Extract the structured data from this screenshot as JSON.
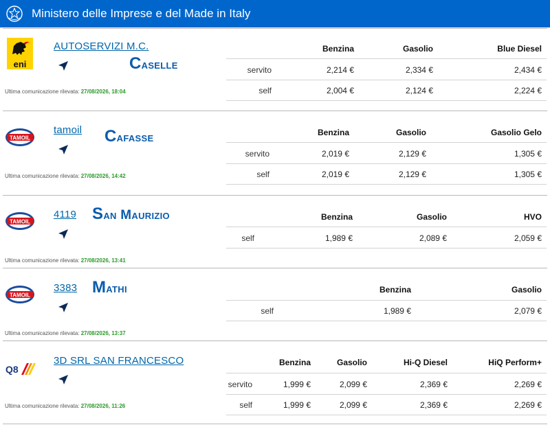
{
  "header": {
    "title": "Ministero delle Imprese e del Made in Italy"
  },
  "last_comm_label": "Ultima comunicazione rilevata:",
  "colors": {
    "header_bg": "#0066cc",
    "link": "#0066aa",
    "city": "#0a5cad",
    "date": "#2a9a2a"
  },
  "stations": [
    {
      "brand": "eni-logo",
      "brand_text": "eni",
      "name": "AUTOSERVIZI M.C.",
      "city": "Caselle",
      "last_comm": "27/08/2026, 18:04",
      "fuels": [
        "Benzina",
        "Gasolio",
        "Blue Diesel"
      ],
      "rows": [
        {
          "service": "servito",
          "prices": [
            "2,214 €",
            "2,334 €",
            "2,434 €"
          ]
        },
        {
          "service": "self",
          "prices": [
            "2,004 €",
            "2,124 €",
            "2,224 €"
          ]
        }
      ]
    },
    {
      "brand": "tamoil-logo",
      "brand_text": "TAMOIL",
      "name": "tamoil",
      "city": "Cafasse",
      "last_comm": "27/08/2026, 14:42",
      "fuels": [
        "Benzina",
        "Gasolio",
        "Gasolio Gelo"
      ],
      "rows": [
        {
          "service": "servito",
          "prices": [
            "2,019 €",
            "2,129 €",
            "1,305 €"
          ]
        },
        {
          "service": "self",
          "prices": [
            "2,019 €",
            "2,129 €",
            "1,305 €"
          ]
        }
      ]
    },
    {
      "brand": "tamoil-logo",
      "brand_text": "TAMOIL",
      "name": "4119",
      "city": "San Maurizio",
      "last_comm": "27/08/2026, 13:41",
      "fuels": [
        "Benzina",
        "Gasolio",
        "HVO"
      ],
      "rows": [
        {
          "service": "self",
          "prices": [
            "1,989 €",
            "2,089 €",
            "2,059 €"
          ]
        }
      ]
    },
    {
      "brand": "tamoil-logo",
      "brand_text": "TAMOIL",
      "name": "3383",
      "city": "Mathi",
      "last_comm": "27/08/2026, 13:37",
      "fuels": [
        "Benzina",
        "Gasolio"
      ],
      "rows": [
        {
          "service": "self",
          "prices": [
            "1,989 €",
            "2,079 €"
          ]
        }
      ]
    },
    {
      "brand": "q8-logo",
      "brand_text": "Q8",
      "name": "3D SRL SAN FRANCESCO",
      "city": "",
      "last_comm": "27/08/2026, 11:26",
      "fuels": [
        "Benzina",
        "Gasolio",
        "Hi-Q Diesel",
        "HiQ Perform+"
      ],
      "rows": [
        {
          "service": "servito",
          "prices": [
            "1,999 €",
            "2,099 €",
            "2,369 €",
            "2,269 €"
          ]
        },
        {
          "service": "self",
          "prices": [
            "1,999 €",
            "2,099 €",
            "2,369 €",
            "2,269 €"
          ]
        }
      ]
    }
  ]
}
